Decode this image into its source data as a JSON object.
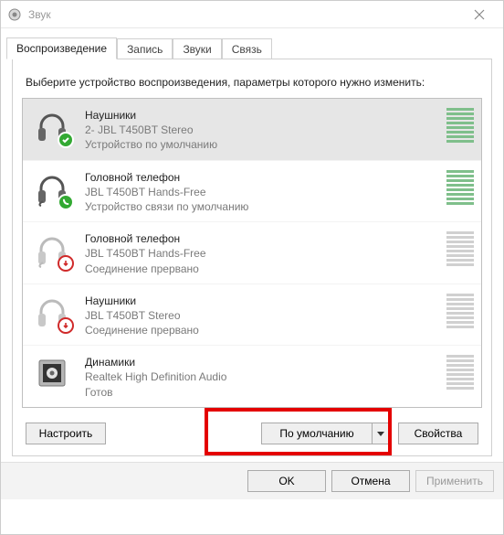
{
  "window": {
    "title": "Звук"
  },
  "tabs": {
    "playback": "Воспроизведение",
    "recording": "Запись",
    "sounds": "Звуки",
    "comm": "Связь"
  },
  "prompt": "Выберите устройство воспроизведения, параметры которого нужно изменить:",
  "devices": [
    {
      "name": "Наушники",
      "sub": "2- JBL T450BT Stereo",
      "status": "Устройство по умолчанию"
    },
    {
      "name": "Головной телефон",
      "sub": "JBL T450BT Hands-Free",
      "status": "Устройство связи по умолчанию"
    },
    {
      "name": "Головной телефон",
      "sub": "JBL T450BT Hands-Free",
      "status": "Соединение прервано"
    },
    {
      "name": "Наушники",
      "sub": "JBL T450BT Stereo",
      "status": "Соединение прервано"
    },
    {
      "name": "Динамики",
      "sub": "Realtek High Definition Audio",
      "status": "Готов"
    }
  ],
  "buttons": {
    "configure": "Настроить",
    "default": "По умолчанию",
    "properties": "Свойства",
    "ok": "OK",
    "cancel": "Отмена",
    "apply": "Применить"
  }
}
